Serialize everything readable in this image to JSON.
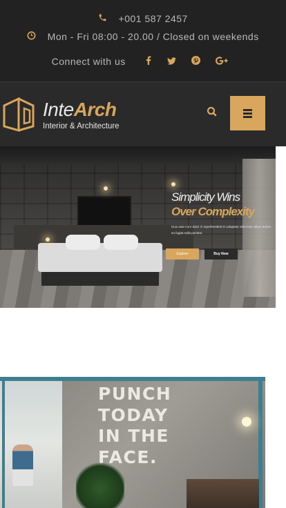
{
  "topbar": {
    "phone": "+001 587 2457",
    "phone_icon": "phone-icon",
    "hours": "Mon - Fri 08:00 - 20.00 / Closed on weekends",
    "hours_icon": "clock-icon",
    "connect_label": "Connect with us",
    "social": [
      {
        "name": "facebook-icon",
        "glyph": "f"
      },
      {
        "name": "twitter-icon",
        "glyph": "t"
      },
      {
        "name": "pinterest-icon",
        "glyph": "p"
      },
      {
        "name": "google-plus-icon",
        "glyph": "G+"
      }
    ]
  },
  "header": {
    "logo_word1": "Inte",
    "logo_word2": "Arch",
    "logo_tagline": "Interior & Architecture",
    "search_icon": "search-icon",
    "menu_icon": "hamburger-menu-icon"
  },
  "hero": {
    "heading_line1": "Simplicity Wins",
    "heading_line2": "Over Complexity",
    "paragraph": "Duis aute irure dolor in reprehenderit in voluptate velit esse cillum dolore eu fugiat nulla pariatur.",
    "button_explore": "Explore",
    "button_buy": "Buy Now"
  },
  "feature_image": {
    "wall_text": "PUNCH\nTODAY\nIN THE\nFACE."
  },
  "colors": {
    "accent": "#d8a65c",
    "topbar_bg": "#222222",
    "header_bg": "#2a2a2a",
    "muted_text": "#b9b9b9"
  }
}
